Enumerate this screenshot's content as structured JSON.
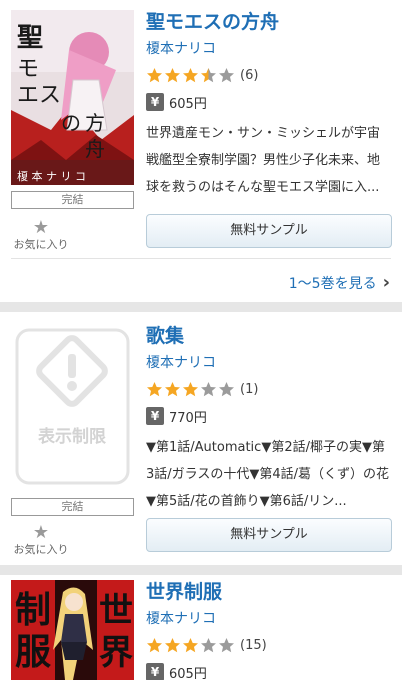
{
  "items": [
    {
      "title": "聖モエスの方舟",
      "author": "榎本ナリコ",
      "stars": [
        1,
        1,
        1,
        0.5,
        0
      ],
      "rating_count": "(6)",
      "price": "605円",
      "description": "世界遺産モン・サン・ミッシェルが宇宙戦艦型全寮制学園？男性少子化未来、地球を救うのはそんな聖モエス学園に入...",
      "badge": "完結",
      "fav_label": "お気に入り",
      "sample_label": "無料サンプル",
      "more_label": "1〜5巻を見る",
      "cover_title": "聖モエスの方舟",
      "cover_author": "榎本ナリコ"
    },
    {
      "title": "歌集",
      "author": "榎本ナリコ",
      "stars": [
        1,
        1,
        1,
        0,
        0
      ],
      "rating_count": "(1)",
      "price": "770円",
      "description": "▼第1話/Automatic▼第2話/椰子の実▼第3話/ガラスの十代▼第4話/葛（くず）の花▼第5話/花の首飾り▼第6話/リン...",
      "badge": "完結",
      "fav_label": "お気に入り",
      "sample_label": "無料サンプル",
      "placeholder_text": "表示制限"
    },
    {
      "title": "世界制服",
      "author": "榎本ナリコ",
      "stars": [
        1,
        1,
        1,
        0,
        0
      ],
      "rating_count": "(15)",
      "price": "605円",
      "cover_text": "制服"
    }
  ],
  "colors": {
    "link": "#1f6fb5",
    "star_on": "#f5a623",
    "star_off": "#9b9b9b"
  },
  "icons": {
    "star": "star-icon",
    "yen": "yen-icon",
    "chevron": "chevron-right-icon",
    "warning": "warning-icon"
  }
}
